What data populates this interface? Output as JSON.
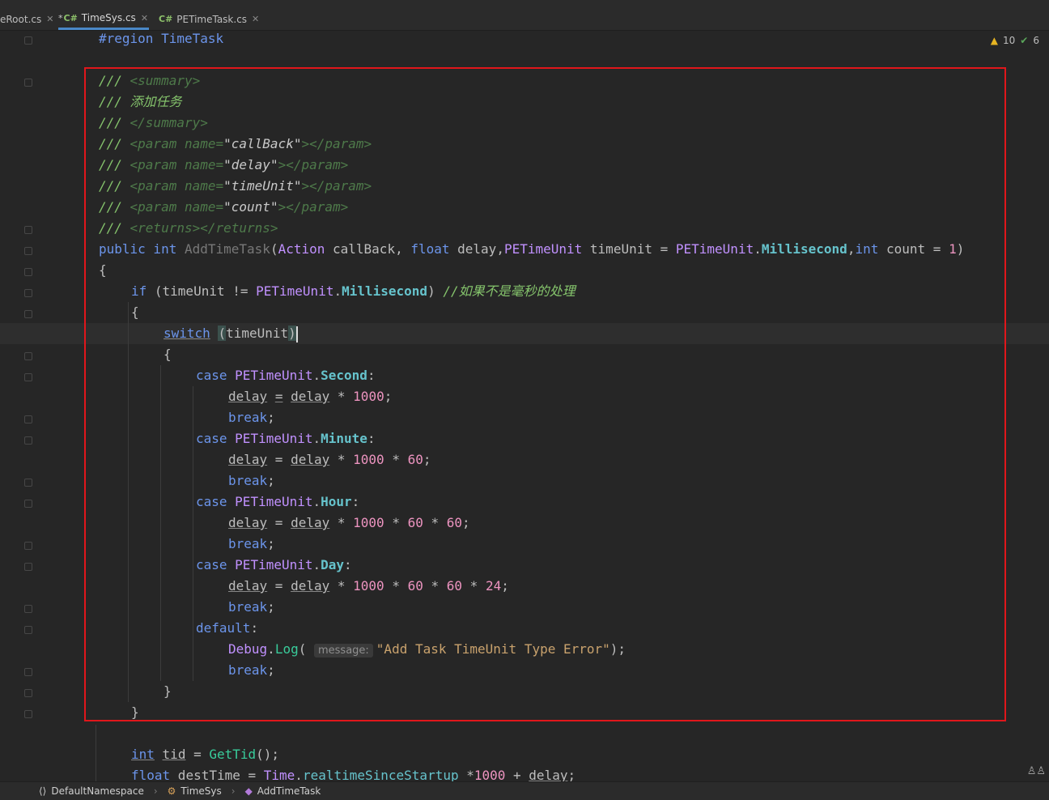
{
  "tabs": [
    {
      "label": "eRoot.cs",
      "modified": false
    },
    {
      "label": "TimeSys.cs",
      "modified": true,
      "icon": "C#"
    },
    {
      "label": "PETimeTask.cs",
      "modified": false,
      "icon": "C#"
    }
  ],
  "inspection": {
    "warnings": "10",
    "ok": "6"
  },
  "code": {
    "region": "#region TimeTask",
    "doc_summary_open": "<summary>",
    "doc_text": "添加任务",
    "doc_summary_close": "</summary>",
    "param_callback": "callBack",
    "param_delay": "delay",
    "param_timeunit": "timeUnit",
    "param_count": "count",
    "comment_not_ms": "//如果不是毫秒的处理",
    "debug_hint": "message:",
    "debug_string": "\"Add Task TimeUnit Type Error\"",
    "num_1000": "1000",
    "num_60": "60",
    "num_24": "24",
    "num_1": "1"
  },
  "breadcrumb": [
    "DefaultNamespace",
    "TimeSys",
    "AddTimeTask"
  ]
}
